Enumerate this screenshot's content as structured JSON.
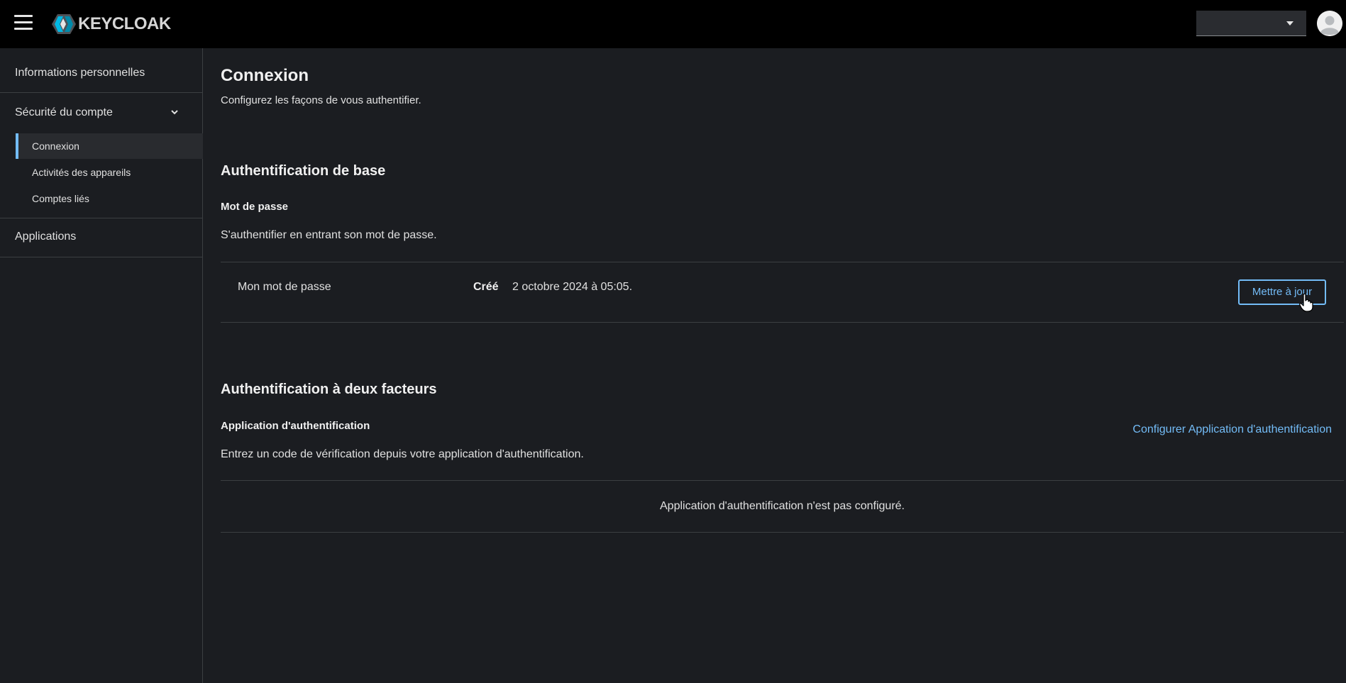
{
  "header": {
    "logo_text": "KEYCLOAK",
    "realm_selected": "",
    "icons": {
      "menu": "hamburger-icon",
      "caret": "caret-down-icon",
      "user": "user-avatar-icon"
    }
  },
  "sidebar": {
    "personal_info": "Informations personnelles",
    "account_security": "Sécurité du compte",
    "sub_items": [
      {
        "label": "Connexion",
        "active": true
      },
      {
        "label": "Activités des appareils",
        "active": false
      },
      {
        "label": "Comptes liés",
        "active": false
      }
    ],
    "applications": "Applications"
  },
  "main": {
    "title": "Connexion",
    "subtitle": "Configurez les façons de vous authentifier.",
    "basic_auth": {
      "title": "Authentification de base",
      "password_title": "Mot de passe",
      "password_desc": "S'authentifier en entrant son mot de passe.",
      "row_label": "Mon mot de passe",
      "created_label": "Créé",
      "created_value": "2 octobre 2024 à 05:05.",
      "update_button": "Mettre à jour"
    },
    "two_factor": {
      "title": "Authentification à deux facteurs",
      "app_title": "Application d'authentification",
      "app_desc": "Entrez un code de vérification depuis votre application d'authentification.",
      "configure_link": "Configurer Application d'authentification",
      "empty_state": "Application d'authentification n'est pas configuré."
    }
  },
  "colors": {
    "accent": "#73bcf7",
    "background": "#1b1d21",
    "masthead": "#000000",
    "separator": "#3c3f42"
  }
}
